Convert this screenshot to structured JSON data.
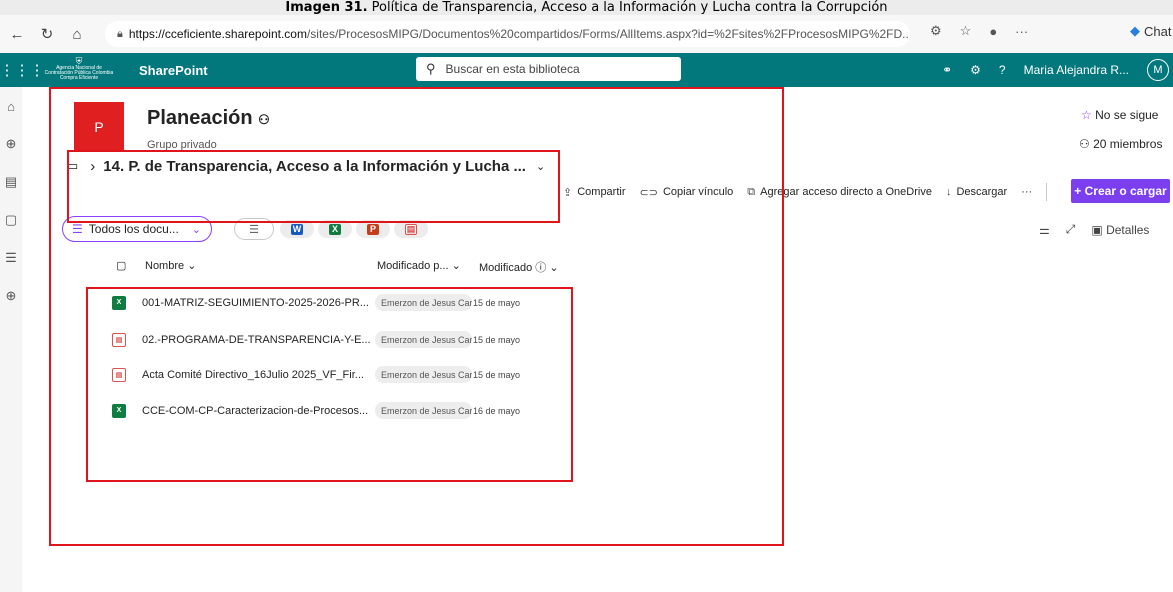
{
  "caption": {
    "prefix": "Imagen 31.",
    "text": " Política de Transparencia, Acceso a la Información y Lucha contra la Corrupción"
  },
  "browser": {
    "url_host": "https://cceficiente.sharepoint.com",
    "url_path": "/sites/ProcesosMIPG/Documentos%20compartidos/Forms/AllItems.aspx?id=%2Fsites%2FProcesosMIPG%2FD...",
    "chat_label": "Chat"
  },
  "spbar": {
    "org_logo_text": "Agencia Nacional de Contratación Pública Colombia Compra Eficiente",
    "app_name": "SharePoint",
    "search_placeholder": "Buscar en esta biblioteca",
    "user_name": "Maria Alejandra R...",
    "avatar_initial": "M"
  },
  "site": {
    "logo_letter": "P",
    "title": "Planeación",
    "subtitle": "Grupo privado",
    "follow_label": "No se sigue",
    "members_label": "20 miembros"
  },
  "breadcrumb": {
    "title": "14. P. de Transparencia, Acceso a la Información y Lucha ..."
  },
  "commands": {
    "share": "Compartir",
    "copy_link": "Copiar vínculo",
    "shortcut": "Agregar acceso directo a OneDrive",
    "download": "Descargar",
    "more": "···",
    "create": "+ Crear o cargar"
  },
  "view": {
    "label": "Todos los docu...",
    "details": "Detalles"
  },
  "columns": {
    "name": "Nombre",
    "modified_by": "Modificado p...",
    "modified": "Modificado"
  },
  "files": [
    {
      "type": "excel",
      "name": "001-MATRIZ-SEGUIMIENTO-2025-2026-PR...",
      "modified_by": "Emerzon de Jesus Car",
      "modified": "15 de mayo"
    },
    {
      "type": "pdf",
      "name": "02.-PROGRAMA-DE-TRANSPARENCIA-Y-E...",
      "modified_by": "Emerzon de Jesus Car",
      "modified": "15 de mayo"
    },
    {
      "type": "pdf",
      "name": "Acta Comité Directivo_16Julio 2025_VF_Fir...",
      "modified_by": "Emerzon de Jesus Car",
      "modified": "15 de mayo"
    },
    {
      "type": "excel",
      "name": "CCE-COM-CP-Caracterizacion-de-Procesos...",
      "modified_by": "Emerzon de Jesus Car",
      "modified": "16 de mayo"
    }
  ],
  "colors": {
    "suite_bar": "#03787c",
    "accent": "#7b3ff0",
    "site_logo": "#e02020",
    "annotation": "#e0141b"
  }
}
